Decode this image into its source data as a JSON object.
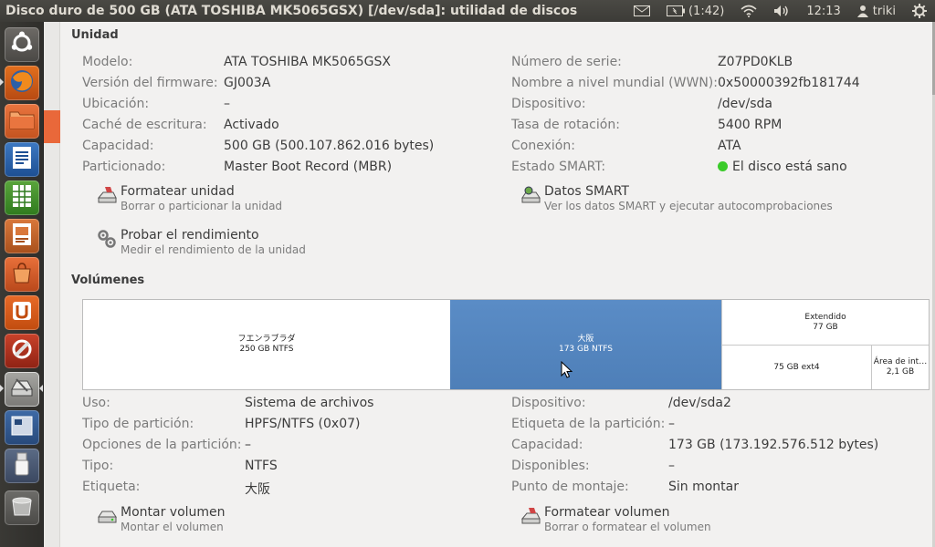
{
  "window": {
    "title": "Disco duro de 500 GB (ATA TOSHIBA MK5065GSX) [/dev/sda]: utilidad de discos"
  },
  "panel": {
    "battery": "(1:42)",
    "clock": "12:13",
    "user": "triki"
  },
  "launcher": {
    "items": [
      "ubuntu-dash",
      "firefox",
      "files",
      "libreoffice-writer",
      "libreoffice-calc",
      "libreoffice-impress",
      "software-center",
      "ubuntu-one",
      "system-settings",
      "disk-utility",
      "workspace-switcher",
      "usb-drive",
      "trash"
    ]
  },
  "unit": {
    "title": "Unidad",
    "left": [
      {
        "label": "Modelo:",
        "value": "ATA TOSHIBA MK5065GSX"
      },
      {
        "label": "Versión del firmware:",
        "value": "GJ003A"
      },
      {
        "label": "Ubicación:",
        "value": "–"
      },
      {
        "label": "Caché de escritura:",
        "value": "Activado"
      },
      {
        "label": "Capacidad:",
        "value": "500 GB (500.107.862.016 bytes)"
      },
      {
        "label": "Particionado:",
        "value": "Master Boot Record (MBR)"
      }
    ],
    "right": [
      {
        "label": "Número de serie:",
        "value": "Z07PD0KLB"
      },
      {
        "label": "Nombre a nivel mundial (WWN):",
        "value": "0x50000392fb181744"
      },
      {
        "label": "Dispositivo:",
        "value": "/dev/sda"
      },
      {
        "label": "Tasa de rotación:",
        "value": "5400 RPM"
      },
      {
        "label": "Conexión:",
        "value": "ATA"
      },
      {
        "label": "Estado SMART:",
        "value": "El disco está sano"
      }
    ],
    "actions": [
      {
        "title": "Formatear unidad",
        "subtitle": "Borrar o particionar la unidad"
      },
      {
        "title": "Datos SMART",
        "subtitle": "Ver los datos SMART y ejecutar autocomprobaciones"
      },
      {
        "title": "Probar el rendimiento",
        "subtitle": "Medir el rendimiento de la unidad"
      }
    ]
  },
  "volumes": {
    "title": "Volúmenes",
    "map": [
      {
        "name": "フエンラブラダ",
        "info": "250 GB NTFS"
      },
      {
        "name": "大阪",
        "info": "173 GB NTFS"
      },
      {
        "name": "Extendido",
        "info": "77 GB"
      },
      {
        "name": "",
        "info": "75 GB ext4"
      },
      {
        "name": "Área de int…",
        "info": "2,1 GB"
      }
    ],
    "left": [
      {
        "label": "Uso:",
        "value": "Sistema de archivos"
      },
      {
        "label": "Tipo de partición:",
        "value": "HPFS/NTFS (0x07)"
      },
      {
        "label": "Opciones de la partición:",
        "value": "–"
      },
      {
        "label": "Tipo:",
        "value": "NTFS"
      },
      {
        "label": "Etiqueta:",
        "value": "大阪"
      }
    ],
    "right": [
      {
        "label": "Dispositivo:",
        "value": "/dev/sda2"
      },
      {
        "label": "Etiqueta de la partición:",
        "value": "–"
      },
      {
        "label": "Capacidad:",
        "value": "173 GB (173.192.576.512 bytes)"
      },
      {
        "label": "Disponibles:",
        "value": "–"
      },
      {
        "label": "Punto de montaje:",
        "value": "Sin montar"
      }
    ],
    "actions": [
      {
        "title": "Montar volumen",
        "subtitle": "Montar el volumen"
      },
      {
        "title": "Formatear volumen",
        "subtitle": "Borrar o formatear el volumen"
      }
    ]
  }
}
